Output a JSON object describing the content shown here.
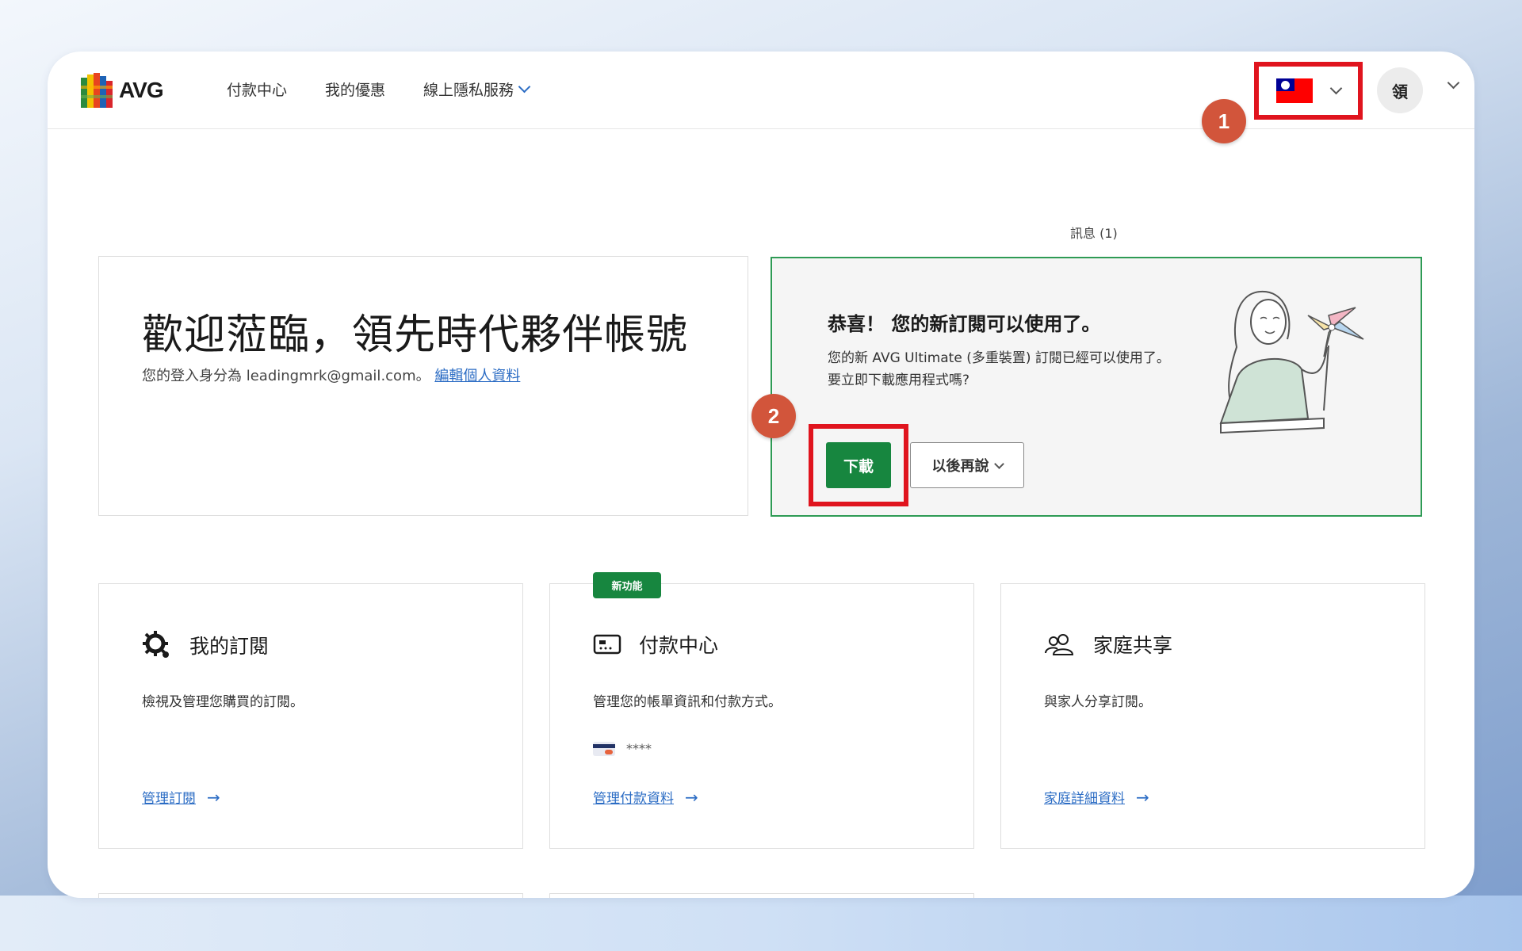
{
  "header": {
    "logo_text": "AVG",
    "nav": [
      {
        "label": "付款中心"
      },
      {
        "label": "我的優惠"
      },
      {
        "label": "線上隱私服務"
      }
    ],
    "avatar_initial": "領"
  },
  "annotations": {
    "step1": "1",
    "step2": "2",
    "highlight_color": "#e0141e",
    "badge_color": "#d2553b"
  },
  "welcome": {
    "title": "歡迎蒞臨，領先時代夥伴帳號",
    "login_prefix": "您的登入身分為 leadingmrk@gmail.com。",
    "edit_profile": "編輯個人資料"
  },
  "messages": {
    "label": "訊息 (1)",
    "title": "恭喜！ 您的新訂閱可以使用了。",
    "body": "您的新 AVG Ultimate (多重裝置) 訂閱已經可以使用了。要立即下載應用程式嗎?",
    "download": "下載",
    "later": "以後再說"
  },
  "cards": [
    {
      "icon": "gear-icon",
      "title": "我的訂閱",
      "desc": "檢視及管理您購買的訂閱。",
      "link": "管理訂閱"
    },
    {
      "icon": "payment-card-icon",
      "tag": "新功能",
      "title": "付款中心",
      "desc": "管理您的帳單資訊和付款方式。",
      "card_mask": "****",
      "link": "管理付款資料"
    },
    {
      "icon": "people-icon",
      "title": "家庭共享",
      "desc": "與家人分享訂閱。",
      "link": "家庭詳細資料"
    }
  ],
  "colors": {
    "brand_green": "#17863f",
    "link_blue": "#2b6cc4",
    "notice_border": "#2e9b55"
  }
}
